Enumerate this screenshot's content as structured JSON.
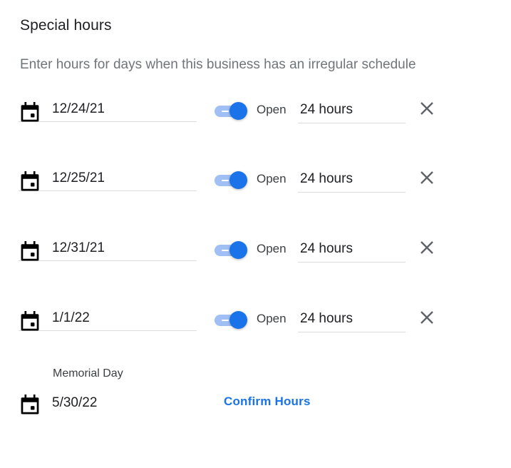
{
  "header": {
    "title": "Special hours",
    "subtitle": "Enter hours for days when this business has an irregular schedule"
  },
  "rows": [
    {
      "date": "12/24/21",
      "open_label": "Open",
      "is_open": true,
      "hours": "24 hours",
      "icon": "calendar-icon",
      "remove_icon": "close-icon"
    },
    {
      "date": "12/25/21",
      "open_label": "Open",
      "is_open": true,
      "hours": "24 hours",
      "icon": "calendar-icon",
      "remove_icon": "close-icon"
    },
    {
      "date": "12/31/21",
      "open_label": "Open",
      "is_open": true,
      "hours": "24 hours",
      "icon": "calendar-icon",
      "remove_icon": "close-icon"
    },
    {
      "date": "1/1/22",
      "open_label": "Open",
      "is_open": true,
      "hours": "24 hours",
      "icon": "calendar-icon",
      "remove_icon": "close-icon"
    }
  ],
  "suggested": {
    "holiday": "Memorial Day",
    "date": "5/30/22",
    "confirm_label": "Confirm Hours",
    "icon": "calendar-icon"
  },
  "colors": {
    "accent": "#1a73e8",
    "toggle_track": "#9fbff5",
    "text_primary": "#202124",
    "text_secondary": "#70757a",
    "divider": "#dadce0",
    "icon_close": "#5f6368"
  }
}
